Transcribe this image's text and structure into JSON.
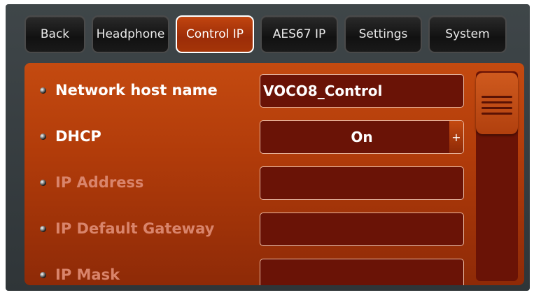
{
  "tabs": [
    {
      "label": "Back",
      "active": false
    },
    {
      "label": "Headphone",
      "active": false
    },
    {
      "label": "Control IP",
      "active": true
    },
    {
      "label": "AES67 IP",
      "active": false
    },
    {
      "label": "Settings",
      "active": false
    },
    {
      "label": "System",
      "active": false
    }
  ],
  "settings": {
    "host_name": {
      "label": "Network host name",
      "value": "VOCO8_Control"
    },
    "dhcp": {
      "label": "DHCP",
      "value": "On",
      "increment": "+"
    },
    "ip_address": {
      "label": "IP Address",
      "value": ""
    },
    "gateway": {
      "label": "IP Default Gateway",
      "value": ""
    },
    "mask": {
      "label": "IP Mask",
      "value": ""
    }
  },
  "colors": {
    "panel": "#b23c0a",
    "field": "#6a1306",
    "disabled_label": "#d9846b"
  }
}
